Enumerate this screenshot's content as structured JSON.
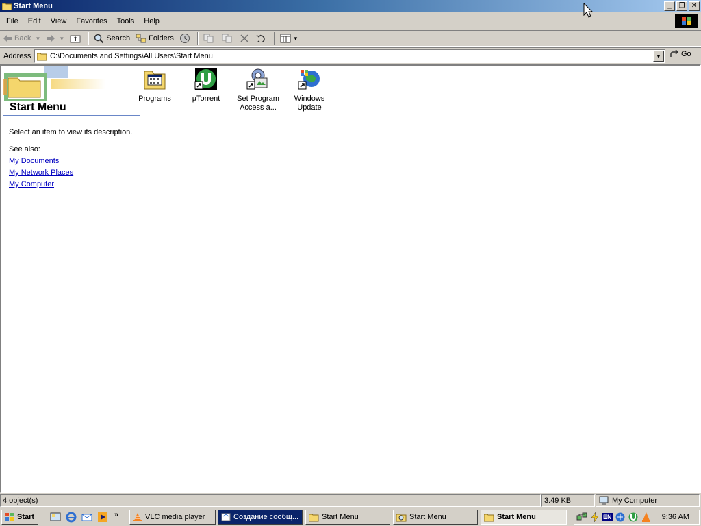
{
  "window": {
    "title": "Start Menu",
    "controls": {
      "minimize": "_",
      "restore": "❐",
      "close": "✕"
    }
  },
  "menu": [
    "File",
    "Edit",
    "View",
    "Favorites",
    "Tools",
    "Help"
  ],
  "toolbar": {
    "back_label": "Back",
    "search_label": "Search",
    "folders_label": "Folders"
  },
  "address": {
    "label": "Address",
    "value": "C:\\Documents and Settings\\All Users\\Start Menu",
    "go_label": "Go"
  },
  "webview": {
    "title": "Start Menu",
    "description": "Select an item to view its description.",
    "see_also_label": "See also:",
    "links": [
      "My Documents",
      "My Network Places",
      "My Computer"
    ]
  },
  "items": [
    {
      "line1": "Programs",
      "line2": "",
      "icon": "programs-folder-icon"
    },
    {
      "line1": "µTorrent",
      "line2": "",
      "icon": "utorrent-shortcut-icon"
    },
    {
      "line1": "Set Program",
      "line2": "Access a...",
      "icon": "set-program-access-shortcut-icon"
    },
    {
      "line1": "Windows",
      "line2": "Update",
      "icon": "windows-update-shortcut-icon"
    }
  ],
  "status": {
    "objects": "4 object(s)",
    "size": "3.49 KB",
    "zone": "My Computer"
  },
  "taskbar": {
    "start_label": "Start",
    "tasks": [
      {
        "label": "VLC media player",
        "icon": "vlc-icon"
      },
      {
        "label": "Создание сообщ...",
        "icon": "browser-window-icon"
      },
      {
        "label": "Start Menu",
        "icon": "folder-icon"
      },
      {
        "label": "Start Menu",
        "icon": "search-folder-icon"
      },
      {
        "label": "Start Menu",
        "icon": "folder-icon"
      }
    ],
    "tray_lang": "EN",
    "clock": "9:36 AM"
  },
  "colors": {
    "title_gradient_start": "#0a246a",
    "title_gradient_end": "#a6caf0",
    "face": "#d4d0c8",
    "link": "#0000c0"
  }
}
